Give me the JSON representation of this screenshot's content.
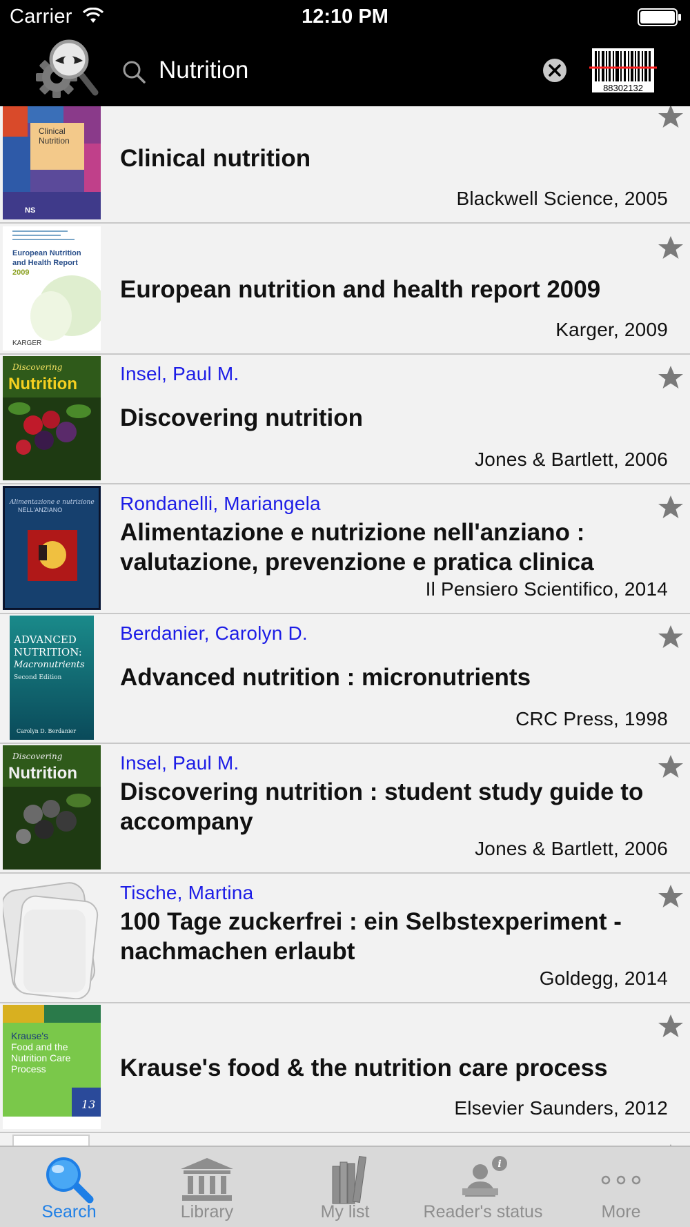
{
  "status_bar": {
    "carrier": "Carrier",
    "time": "12:10 PM"
  },
  "header": {
    "search_query": "Nutrition",
    "barcode_number": "88302132"
  },
  "results": [
    {
      "author": "",
      "title": "Clinical nutrition",
      "publisher": "Blackwell Science, 2005",
      "cover_text": [
        "Clinical",
        "Nutrition",
        "NS"
      ]
    },
    {
      "author": "",
      "title": "European nutrition and health report 2009",
      "publisher": "Karger, 2009",
      "cover_text": [
        "European Nutrition",
        "and Health Report",
        "2009",
        "KARGER"
      ]
    },
    {
      "author": "Insel, Paul M.",
      "title": "Discovering nutrition",
      "publisher": "Jones & Bartlett, 2006",
      "cover_text": [
        "Discovering",
        "Nutrition"
      ]
    },
    {
      "author": "Rondanelli, Mariangela",
      "title": "Alimentazione e nutrizione nell'anziano : valutazione, prevenzione e pratica clinica",
      "publisher": "Il Pensiero Scientifico, 2014",
      "cover_text": [
        "Alimentazione e nutrizione",
        "NELL'ANZIANO"
      ]
    },
    {
      "author": "Berdanier, Carolyn D.",
      "title": "Advanced nutrition : micronutrients",
      "publisher": "CRC Press, 1998",
      "cover_text": [
        "ADVANCED",
        "NUTRITION:",
        "Macronutrients",
        "Second Edition",
        "Carolyn D. Berdanier"
      ]
    },
    {
      "author": "Insel, Paul M.",
      "title": "Discovering nutrition : student study guide to accompany",
      "publisher": "Jones & Bartlett, 2006",
      "cover_text": [
        "Discovering",
        "Nutrition"
      ]
    },
    {
      "author": "Tische, Martina",
      "title": "100 Tage zuckerfrei : ein Selbstexperiment - nachmachen erlaubt",
      "publisher": "Goldegg, 2014",
      "cover_text": []
    },
    {
      "author": "",
      "title": "Krause's food & the nutrition care process",
      "publisher": "Elsevier Saunders, 2012",
      "cover_text": [
        "Krause's",
        "Food and the",
        "Nutrition Care",
        "Process",
        "13"
      ]
    }
  ],
  "tabs": [
    {
      "label": "Search",
      "icon": "search-icon",
      "active": true
    },
    {
      "label": "Library",
      "icon": "library-icon",
      "active": false
    },
    {
      "label": "My list",
      "icon": "books-icon",
      "active": false
    },
    {
      "label": "Reader's status",
      "icon": "reader-info-icon",
      "active": false
    },
    {
      "label": "More",
      "icon": "more-icon",
      "active": false
    }
  ],
  "colors": {
    "author": "#1c1ce6",
    "tab_active": "#1e7fe6",
    "tab_inactive": "#8e8e8e",
    "header_bg": "#000000"
  }
}
